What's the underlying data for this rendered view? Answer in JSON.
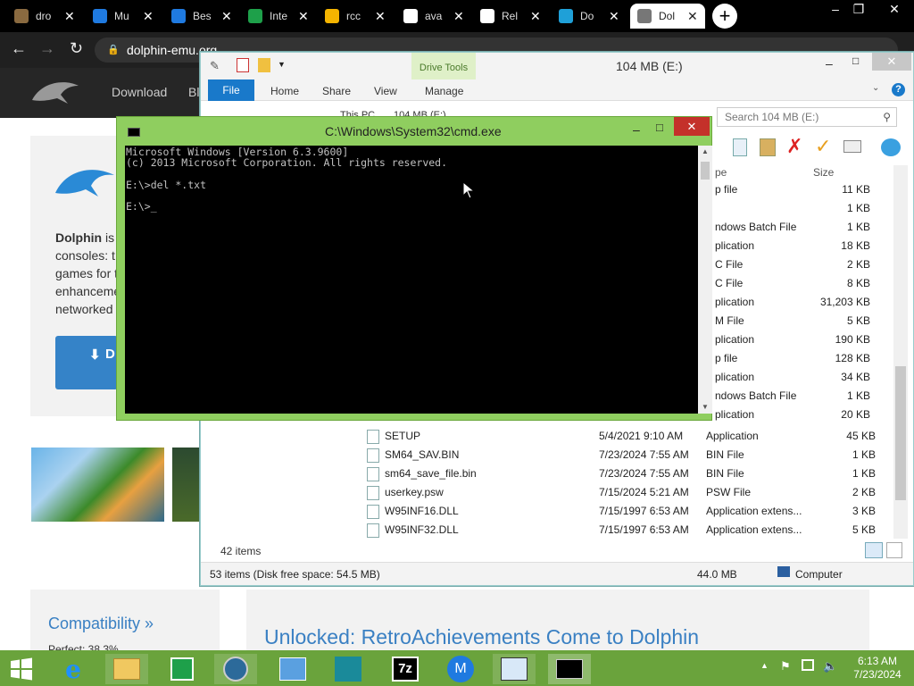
{
  "browser": {
    "tabs": [
      {
        "label": "dro",
        "color": "#8a6a40"
      },
      {
        "label": "Mu",
        "color": "#1f7ae0"
      },
      {
        "label": "Bes",
        "color": "#1f7ae0"
      },
      {
        "label": "Inte",
        "color": "#1ea04a"
      },
      {
        "label": "rcc",
        "color": "#f4b400"
      },
      {
        "label": "ava",
        "color": "#ffffff"
      },
      {
        "label": "Rel",
        "color": "#ffffff"
      },
      {
        "label": "Do",
        "color": "#1fa0d8"
      },
      {
        "label": "Dol",
        "color": "#777777"
      }
    ],
    "new_tab": "+",
    "window_controls": [
      "–",
      "❐",
      "✕"
    ],
    "url": "dolphin-emu.org"
  },
  "website": {
    "nav": [
      "Download",
      "Bl"
    ],
    "hero_lines": [
      "Dolphin is",
      "consoles: t",
      "games for t",
      "enhanceme",
      "networked"
    ],
    "hero_strong": "Dolphin",
    "hero_rest": " is",
    "download_label": "D",
    "compat_title": "Compatibility »",
    "compat_sub": "Perfect: 38.3%",
    "news_title": "Unlocked: RetroAchievements Come to Dolphin"
  },
  "explorer": {
    "title": "104 MB (E:)",
    "contextual_tab": "Drive Tools",
    "ribbon_tabs": [
      "File",
      "Home",
      "Share",
      "View",
      "Manage"
    ],
    "breadcrumb": [
      "This PC",
      "104 MB (E:)"
    ],
    "search_placeholder": "Search 104 MB (E:)",
    "size_header": "Size",
    "type_header": "pe",
    "hidden_rows": [
      {
        "type": "p file",
        "size": "11 KB"
      },
      {
        "type": "",
        "size": "1 KB"
      },
      {
        "type": "ndows Batch File",
        "size": "1 KB"
      },
      {
        "type": "plication",
        "size": "18 KB"
      },
      {
        "type": "C File",
        "size": "2 KB"
      },
      {
        "type": "C File",
        "size": "8 KB"
      },
      {
        "type": "plication",
        "size": "31,203 KB"
      },
      {
        "type": "M File",
        "size": "5 KB"
      },
      {
        "type": "plication",
        "size": "190 KB"
      },
      {
        "type": "p file",
        "size": "128 KB"
      },
      {
        "type": "plication",
        "size": "34 KB"
      },
      {
        "type": "ndows Batch File",
        "size": "1 KB"
      },
      {
        "type": "plication",
        "size": "20 KB"
      }
    ],
    "files": [
      {
        "name": "SETUP",
        "date": "5/4/2021 9:10 AM",
        "type": "Application",
        "size": "45 KB"
      },
      {
        "name": "SM64_SAV.BIN",
        "date": "7/23/2024 7:55 AM",
        "type": "BIN File",
        "size": "1 KB"
      },
      {
        "name": "sm64_save_file.bin",
        "date": "7/23/2024 7:55 AM",
        "type": "BIN File",
        "size": "1 KB"
      },
      {
        "name": "userkey.psw",
        "date": "7/15/2024 5:21 AM",
        "type": "PSW File",
        "size": "2 KB"
      },
      {
        "name": "W95INF16.DLL",
        "date": "7/15/1997 6:53 AM",
        "type": "Application extens...",
        "size": "3 KB"
      },
      {
        "name": "W95INF32.DLL",
        "date": "7/15/1997 6:53 AM",
        "type": "Application extens...",
        "size": "5 KB"
      }
    ],
    "item_count": "42 items",
    "status_left": "53 items (Disk free space: 54.5 MB)",
    "status_size": "44.0 MB",
    "status_location": "Computer"
  },
  "cmd": {
    "title": "C:\\Windows\\System32\\cmd.exe",
    "lines": [
      "Microsoft Windows [Version 6.3.9600]",
      "(c) 2013 Microsoft Corporation. All rights reserved.",
      "",
      "E:\\>del *.txt",
      "",
      "E:\\>_"
    ]
  },
  "taskbar": {
    "time": "6:13 AM",
    "date": "7/23/2024",
    "zip_label": "7z"
  }
}
